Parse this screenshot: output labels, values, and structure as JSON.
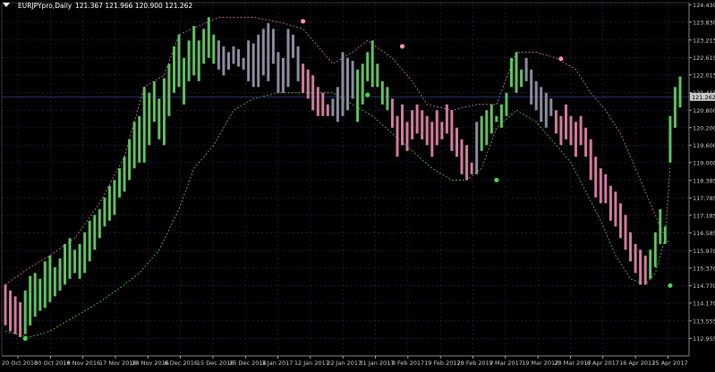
{
  "header": {
    "symbol_label": "EURJPYpro,Daily",
    "ohlc_values": "121.367 121.966 120.900 121.262"
  },
  "colors": {
    "background": "#000000",
    "grid": "#2a2a55",
    "axis": "#c8c8c8",
    "bull": "#5fbf5f",
    "bear": "#d07a9a",
    "neutral": "#8a8a9e",
    "band_upper": "#d07a9a",
    "band_lower": "#5fbf5f",
    "current_price_line": "#3a3a8a",
    "price_tag_bg": "#c8c8c8",
    "price_tag_text": "#000000"
  },
  "chart_data": {
    "type": "bar",
    "instrument": "EURJPYpro",
    "timeframe": "Daily",
    "ohlc_current": {
      "open": 121.367,
      "high": 121.966,
      "low": 120.9,
      "close": 121.262
    },
    "current_price_label": "121.262",
    "ylim": [
      112.35,
      124.5
    ],
    "y_ticks": [
      "124.430",
      "123.830",
      "123.215",
      "122.615",
      "122.015",
      "121.415",
      "120.800",
      "120.200",
      "119.600",
      "119.000",
      "118.385",
      "117.785",
      "117.185",
      "116.585",
      "115.970",
      "115.370",
      "114.770",
      "114.170",
      "113.555",
      "112.955"
    ],
    "x_labels": [
      "20 Oct 2016",
      "30 Oct 2016",
      "8 Nov 2016",
      "17 Nov 2016",
      "28 Nov 2016",
      "6 Dec 2016",
      "15 Dec 2016",
      "25 Dec 2016",
      "3 Jan 2017",
      "12 Jan 2017",
      "22 Jan 2017",
      "31 Jan 2017",
      "9 Feb 2017",
      "19 Feb 2017",
      "28 Feb 2017",
      "9 Mar 2017",
      "19 Mar 2017",
      "28 Mar 2017",
      "6 Apr 2017",
      "16 Apr 2017",
      "25 Apr 2017"
    ],
    "grid": true,
    "bars": [
      {
        "h": 114.8,
        "l": 113.4,
        "c": "bear"
      },
      {
        "h": 114.6,
        "l": 113.2,
        "c": "bear"
      },
      {
        "h": 114.4,
        "l": 113.1,
        "c": "bear"
      },
      {
        "h": 114.2,
        "l": 113.0,
        "c": "bear"
      },
      {
        "h": 114.6,
        "l": 113.1,
        "c": "bull"
      },
      {
        "h": 115.1,
        "l": 113.4,
        "c": "bull"
      },
      {
        "h": 115.2,
        "l": 113.7,
        "c": "bull"
      },
      {
        "h": 115.0,
        "l": 113.9,
        "c": "bull"
      },
      {
        "h": 115.6,
        "l": 114.0,
        "c": "bull"
      },
      {
        "h": 115.8,
        "l": 114.2,
        "c": "bull"
      },
      {
        "h": 115.4,
        "l": 114.4,
        "c": "bull"
      },
      {
        "h": 115.7,
        "l": 114.6,
        "c": "bull"
      },
      {
        "h": 116.2,
        "l": 114.8,
        "c": "bull"
      },
      {
        "h": 116.4,
        "l": 115.0,
        "c": "bull"
      },
      {
        "h": 116.0,
        "l": 115.2,
        "c": "bull"
      },
      {
        "h": 116.2,
        "l": 115.0,
        "c": "bull"
      },
      {
        "h": 116.6,
        "l": 115.2,
        "c": "bull"
      },
      {
        "h": 117.0,
        "l": 115.6,
        "c": "bull"
      },
      {
        "h": 117.2,
        "l": 116.0,
        "c": "bull"
      },
      {
        "h": 117.4,
        "l": 116.4,
        "c": "bull"
      },
      {
        "h": 117.8,
        "l": 116.8,
        "c": "bull"
      },
      {
        "h": 118.2,
        "l": 117.0,
        "c": "bull"
      },
      {
        "h": 118.4,
        "l": 117.2,
        "c": "bull"
      },
      {
        "h": 118.8,
        "l": 117.8,
        "c": "bull"
      },
      {
        "h": 119.2,
        "l": 118.0,
        "c": "bull"
      },
      {
        "h": 119.8,
        "l": 118.4,
        "c": "bull"
      },
      {
        "h": 120.4,
        "l": 118.8,
        "c": "bull"
      },
      {
        "h": 120.6,
        "l": 119.0,
        "c": "bull"
      },
      {
        "h": 121.6,
        "l": 119.0,
        "c": "bull"
      },
      {
        "h": 121.4,
        "l": 119.6,
        "c": "bull"
      },
      {
        "h": 121.8,
        "l": 120.4,
        "c": "bull"
      },
      {
        "h": 121.2,
        "l": 119.8,
        "c": "bull"
      },
      {
        "h": 121.9,
        "l": 119.6,
        "c": "bull"
      },
      {
        "h": 122.4,
        "l": 120.6,
        "c": "bull"
      },
      {
        "h": 123.0,
        "l": 121.4,
        "c": "bull"
      },
      {
        "h": 123.4,
        "l": 121.6,
        "c": "bull"
      },
      {
        "h": 122.6,
        "l": 121.0,
        "c": "bull"
      },
      {
        "h": 123.2,
        "l": 121.8,
        "c": "bull"
      },
      {
        "h": 123.7,
        "l": 122.0,
        "c": "bull"
      },
      {
        "h": 123.2,
        "l": 121.8,
        "c": "bull"
      },
      {
        "h": 123.6,
        "l": 122.4,
        "c": "bull"
      },
      {
        "h": 124.0,
        "l": 122.6,
        "c": "bull"
      },
      {
        "h": 123.4,
        "l": 122.4,
        "c": "bull"
      },
      {
        "h": 123.2,
        "l": 122.2,
        "c": "neutral"
      },
      {
        "h": 123.0,
        "l": 122.0,
        "c": "neutral"
      },
      {
        "h": 122.8,
        "l": 122.2,
        "c": "neutral"
      },
      {
        "h": 123.0,
        "l": 122.4,
        "c": "neutral"
      },
      {
        "h": 122.9,
        "l": 122.3,
        "c": "neutral"
      },
      {
        "h": 122.6,
        "l": 122.2,
        "c": "neutral"
      },
      {
        "h": 123.2,
        "l": 121.8,
        "c": "neutral"
      },
      {
        "h": 123.1,
        "l": 121.6,
        "c": "neutral"
      },
      {
        "h": 123.4,
        "l": 121.6,
        "c": "neutral"
      },
      {
        "h": 123.6,
        "l": 122.0,
        "c": "neutral"
      },
      {
        "h": 123.8,
        "l": 121.8,
        "c": "neutral"
      },
      {
        "h": 123.6,
        "l": 122.4,
        "c": "neutral"
      },
      {
        "h": 122.8,
        "l": 121.4,
        "c": "neutral"
      },
      {
        "h": 122.6,
        "l": 121.4,
        "c": "neutral"
      },
      {
        "h": 123.6,
        "l": 121.6,
        "c": "neutral"
      },
      {
        "h": 123.4,
        "l": 122.6,
        "c": "neutral"
      },
      {
        "h": 123.0,
        "l": 121.8,
        "c": "neutral"
      },
      {
        "h": 122.4,
        "l": 121.4,
        "c": "bear"
      },
      {
        "h": 122.2,
        "l": 121.2,
        "c": "bear"
      },
      {
        "h": 122.0,
        "l": 120.8,
        "c": "bear"
      },
      {
        "h": 121.6,
        "l": 120.6,
        "c": "bear"
      },
      {
        "h": 121.4,
        "l": 120.6,
        "c": "bear"
      },
      {
        "h": 121.0,
        "l": 120.6,
        "c": "bear"
      },
      {
        "h": 121.2,
        "l": 120.6,
        "c": "neutral"
      },
      {
        "h": 121.6,
        "l": 120.4,
        "c": "neutral"
      },
      {
        "h": 122.8,
        "l": 120.6,
        "c": "neutral"
      },
      {
        "h": 122.6,
        "l": 120.8,
        "c": "neutral"
      },
      {
        "h": 122.5,
        "l": 121.2,
        "c": "neutral"
      },
      {
        "h": 122.2,
        "l": 120.4,
        "c": "bull"
      },
      {
        "h": 122.4,
        "l": 121.0,
        "c": "bull"
      },
      {
        "h": 122.8,
        "l": 121.8,
        "c": "bull"
      },
      {
        "h": 123.2,
        "l": 121.6,
        "c": "bull"
      },
      {
        "h": 122.4,
        "l": 121.6,
        "c": "bull"
      },
      {
        "h": 121.8,
        "l": 121.0,
        "c": "bull"
      },
      {
        "h": 121.6,
        "l": 120.8,
        "c": "bull"
      },
      {
        "h": 121.2,
        "l": 120.2,
        "c": "bear"
      },
      {
        "h": 120.6,
        "l": 119.2,
        "c": "bear"
      },
      {
        "h": 121.0,
        "l": 119.6,
        "c": "bear"
      },
      {
        "h": 120.4,
        "l": 119.4,
        "c": "bear"
      },
      {
        "h": 120.8,
        "l": 119.8,
        "c": "bear"
      },
      {
        "h": 121.0,
        "l": 120.0,
        "c": "bear"
      },
      {
        "h": 120.8,
        "l": 119.8,
        "c": "bear"
      },
      {
        "h": 120.6,
        "l": 119.6,
        "c": "bear"
      },
      {
        "h": 120.4,
        "l": 119.2,
        "c": "bear"
      },
      {
        "h": 120.8,
        "l": 119.6,
        "c": "bear"
      },
      {
        "h": 120.4,
        "l": 119.8,
        "c": "bear"
      },
      {
        "h": 121.0,
        "l": 120.0,
        "c": "bear"
      },
      {
        "h": 120.8,
        "l": 119.4,
        "c": "bear"
      },
      {
        "h": 120.2,
        "l": 119.2,
        "c": "bear"
      },
      {
        "h": 119.8,
        "l": 118.6,
        "c": "bear"
      },
      {
        "h": 119.6,
        "l": 118.4,
        "c": "bear"
      },
      {
        "h": 119.0,
        "l": 118.6,
        "c": "bear"
      },
      {
        "h": 120.4,
        "l": 118.6,
        "c": "neutral"
      },
      {
        "h": 120.6,
        "l": 119.4,
        "c": "bull"
      },
      {
        "h": 120.8,
        "l": 119.6,
        "c": "bull"
      },
      {
        "h": 121.0,
        "l": 120.0,
        "c": "bull"
      },
      {
        "h": 120.6,
        "l": 120.4,
        "c": "bull"
      },
      {
        "h": 121.0,
        "l": 120.2,
        "c": "bull"
      },
      {
        "h": 121.4,
        "l": 120.6,
        "c": "bull"
      },
      {
        "h": 122.6,
        "l": 121.6,
        "c": "bull"
      },
      {
        "h": 122.8,
        "l": 121.4,
        "c": "bull"
      },
      {
        "h": 122.2,
        "l": 121.6,
        "c": "bull"
      },
      {
        "h": 122.6,
        "l": 121.8,
        "c": "neutral"
      },
      {
        "h": 122.2,
        "l": 121.0,
        "c": "neutral"
      },
      {
        "h": 121.8,
        "l": 120.8,
        "c": "neutral"
      },
      {
        "h": 121.6,
        "l": 120.4,
        "c": "neutral"
      },
      {
        "h": 121.4,
        "l": 120.2,
        "c": "neutral"
      },
      {
        "h": 121.2,
        "l": 120.6,
        "c": "neutral"
      },
      {
        "h": 120.8,
        "l": 120.0,
        "c": "bear"
      },
      {
        "h": 120.6,
        "l": 119.6,
        "c": "bear"
      },
      {
        "h": 121.0,
        "l": 119.8,
        "c": "bear"
      },
      {
        "h": 120.6,
        "l": 119.6,
        "c": "bear"
      },
      {
        "h": 120.4,
        "l": 119.2,
        "c": "bear"
      },
      {
        "h": 120.6,
        "l": 119.6,
        "c": "bear"
      },
      {
        "h": 120.2,
        "l": 119.2,
        "c": "bear"
      },
      {
        "h": 119.8,
        "l": 118.4,
        "c": "bear"
      },
      {
        "h": 119.2,
        "l": 117.8,
        "c": "bear"
      },
      {
        "h": 118.8,
        "l": 117.6,
        "c": "bear"
      },
      {
        "h": 118.6,
        "l": 117.6,
        "c": "bear"
      },
      {
        "h": 118.2,
        "l": 117.0,
        "c": "bear"
      },
      {
        "h": 118.0,
        "l": 116.8,
        "c": "bear"
      },
      {
        "h": 117.6,
        "l": 116.4,
        "c": "bear"
      },
      {
        "h": 117.2,
        "l": 116.0,
        "c": "bear"
      },
      {
        "h": 116.6,
        "l": 115.6,
        "c": "bear"
      },
      {
        "h": 116.2,
        "l": 115.2,
        "c": "bear"
      },
      {
        "h": 116.0,
        "l": 114.8,
        "c": "bear"
      },
      {
        "h": 115.8,
        "l": 114.8,
        "c": "bear"
      },
      {
        "h": 116.0,
        "l": 115.0,
        "c": "bull"
      },
      {
        "h": 116.6,
        "l": 115.4,
        "c": "bull"
      },
      {
        "h": 117.4,
        "l": 116.2,
        "c": "bull"
      },
      {
        "h": 116.8,
        "l": 116.2,
        "c": "bull"
      },
      {
        "h": 120.6,
        "l": 119.0,
        "c": "bull"
      },
      {
        "h": 121.6,
        "l": 120.2,
        "c": "bull"
      },
      {
        "h": 121.96,
        "l": 120.9,
        "c": "bull"
      }
    ],
    "upper_band": [
      [
        0,
        114.8
      ],
      [
        5,
        115.4
      ],
      [
        9,
        115.8
      ],
      [
        14,
        116.4
      ],
      [
        19,
        117.6
      ],
      [
        24,
        119.2
      ],
      [
        28,
        121.6
      ],
      [
        32,
        122.0
      ],
      [
        35,
        123.4
      ],
      [
        39,
        123.7
      ],
      [
        43,
        124.0
      ],
      [
        50,
        124.0
      ],
      [
        56,
        123.8
      ],
      [
        60,
        123.6
      ],
      [
        63,
        123.0
      ],
      [
        66,
        122.4
      ],
      [
        70,
        122.8
      ],
      [
        73,
        123.2
      ],
      [
        78,
        122.6
      ],
      [
        82,
        121.8
      ],
      [
        85,
        121.0
      ],
      [
        90,
        120.8
      ],
      [
        95,
        121.0
      ],
      [
        99,
        121.0
      ],
      [
        103,
        122.8
      ],
      [
        107,
        122.8
      ],
      [
        111,
        122.6
      ],
      [
        115,
        122.2
      ],
      [
        118,
        121.4
      ],
      [
        121,
        120.8
      ],
      [
        124,
        120.0
      ],
      [
        127,
        118.8
      ],
      [
        130,
        117.6
      ],
      [
        133,
        116.4
      ],
      [
        134,
        116.2
      ]
    ],
    "lower_band": [
      [
        0,
        113.2
      ],
      [
        5,
        113.0
      ],
      [
        9,
        113.2
      ],
      [
        14,
        113.7
      ],
      [
        19,
        114.2
      ],
      [
        24,
        114.8
      ],
      [
        27,
        115.2
      ],
      [
        31,
        116.0
      ],
      [
        35,
        117.4
      ],
      [
        38,
        118.8
      ],
      [
        42,
        119.6
      ],
      [
        46,
        120.8
      ],
      [
        50,
        121.2
      ],
      [
        55,
        121.4
      ],
      [
        60,
        121.4
      ],
      [
        63,
        121.4
      ],
      [
        66,
        121.4
      ],
      [
        70,
        121.0
      ],
      [
        74,
        120.6
      ],
      [
        78,
        120.0
      ],
      [
        82,
        119.4
      ],
      [
        86,
        118.8
      ],
      [
        90,
        118.4
      ],
      [
        93,
        118.4
      ],
      [
        96,
        118.8
      ],
      [
        99,
        120.2
      ],
      [
        103,
        120.8
      ],
      [
        107,
        120.4
      ],
      [
        111,
        119.6
      ],
      [
        114,
        119.0
      ],
      [
        117,
        118.0
      ],
      [
        120,
        117.0
      ],
      [
        123,
        115.8
      ],
      [
        126,
        115.0
      ],
      [
        129,
        114.8
      ],
      [
        131,
        115.2
      ],
      [
        133,
        116.4
      ],
      [
        134,
        118.9
      ]
    ],
    "signal_dots": [
      {
        "i": 4,
        "price": 112.95,
        "type": "buy"
      },
      {
        "i": 60,
        "price": 123.86,
        "type": "sell"
      },
      {
        "i": 73,
        "price": 121.33,
        "type": "buy"
      },
      {
        "i": 80,
        "price": 123.0,
        "type": "sell"
      },
      {
        "i": 99,
        "price": 118.4,
        "type": "buy"
      },
      {
        "i": 112,
        "price": 122.57,
        "type": "sell"
      },
      {
        "i": 134,
        "price": 114.77,
        "type": "buy"
      }
    ]
  }
}
